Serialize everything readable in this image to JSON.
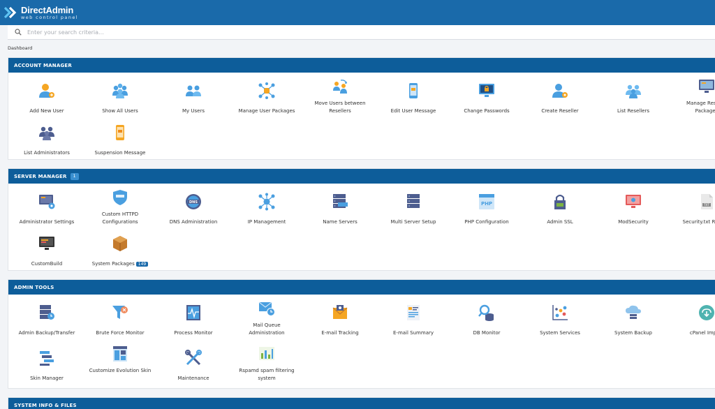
{
  "app": {
    "title": "DirectAdmin",
    "subtitle": "web control panel"
  },
  "search": {
    "placeholder": "Enter your search criteria..."
  },
  "breadcrumb": "Dashboard",
  "sections": {
    "account": {
      "title": "ACCOUNT MANAGER",
      "items": [
        {
          "label": "Add New User",
          "icon": "add-user-icon"
        },
        {
          "label": "Show All Users",
          "icon": "users-group-icon"
        },
        {
          "label": "My Users",
          "icon": "users-icon"
        },
        {
          "label": "Manage User Packages",
          "icon": "packages-network-icon"
        },
        {
          "label": "Move Users between Resellers",
          "icon": "move-users-icon"
        },
        {
          "label": "Edit User Message",
          "icon": "phone-message-icon"
        },
        {
          "label": "Change Passwords",
          "icon": "monitor-lock-icon"
        },
        {
          "label": "Create Reseller",
          "icon": "create-reseller-icon"
        },
        {
          "label": "List Resellers",
          "icon": "resellers-icon"
        },
        {
          "label": "Manage Reseller Packages",
          "icon": "reseller-packages-icon"
        },
        {
          "label": "List Administrators",
          "icon": "administrators-icon"
        },
        {
          "label": "Suspension Message",
          "icon": "suspension-message-icon"
        }
      ]
    },
    "server": {
      "title": "SERVER MANAGER",
      "badge": "1",
      "items": [
        {
          "label": "Administrator Settings",
          "icon": "admin-settings-icon"
        },
        {
          "label": "Custom HTTPD Configurations",
          "icon": "httpd-shield-icon"
        },
        {
          "label": "DNS Administration",
          "icon": "dns-icon"
        },
        {
          "label": "IP Management",
          "icon": "ip-network-icon"
        },
        {
          "label": "Name Servers",
          "icon": "name-servers-icon"
        },
        {
          "label": "Multi Server Setup",
          "icon": "multi-server-icon"
        },
        {
          "label": "PHP Configuration",
          "icon": "php-icon"
        },
        {
          "label": "Admin SSL",
          "icon": "ssl-lock-icon"
        },
        {
          "label": "ModSecurity",
          "icon": "modsecurity-icon"
        },
        {
          "label": "Security.txt Reports",
          "icon": "txt-file-icon"
        },
        {
          "label": "CustomBuild",
          "icon": "custombuild-icon"
        },
        {
          "label": "System Packages",
          "icon": "box-icon",
          "badge": "149"
        }
      ]
    },
    "tools": {
      "title": "ADMIN TOOLS",
      "items": [
        {
          "label": "Admin Backup/Transfer",
          "icon": "backup-transfer-icon"
        },
        {
          "label": "Brute Force Monitor",
          "icon": "funnel-icon"
        },
        {
          "label": "Process Monitor",
          "icon": "process-monitor-icon"
        },
        {
          "label": "Mail Queue Administration",
          "icon": "mail-queue-icon"
        },
        {
          "label": "E-mail Tracking",
          "icon": "email-tracking-icon"
        },
        {
          "label": "E-mail Summary",
          "icon": "email-summary-icon"
        },
        {
          "label": "DB Monitor",
          "icon": "db-monitor-icon"
        },
        {
          "label": "System Services",
          "icon": "system-services-icon"
        },
        {
          "label": "System Backup",
          "icon": "cloud-backup-icon"
        },
        {
          "label": "cPanel Import",
          "icon": "cpanel-import-icon"
        },
        {
          "label": "Skin Manager",
          "icon": "skin-manager-icon"
        },
        {
          "label": "Customize Evolution Skin",
          "icon": "customize-skin-icon"
        },
        {
          "label": "Maintenance",
          "icon": "maintenance-tools-icon"
        },
        {
          "label": "Rspamd spam filtering system",
          "icon": "rspamd-chart-icon"
        }
      ]
    },
    "sysinfo": {
      "title": "SYSTEM INFO & FILES"
    }
  },
  "colors": {
    "header": "#1a6aaa",
    "section_header": "#0d5d9a",
    "accent_orange": "#f5a623",
    "accent_blue": "#4a9fe0",
    "accent_navy": "#4d5d8f"
  }
}
